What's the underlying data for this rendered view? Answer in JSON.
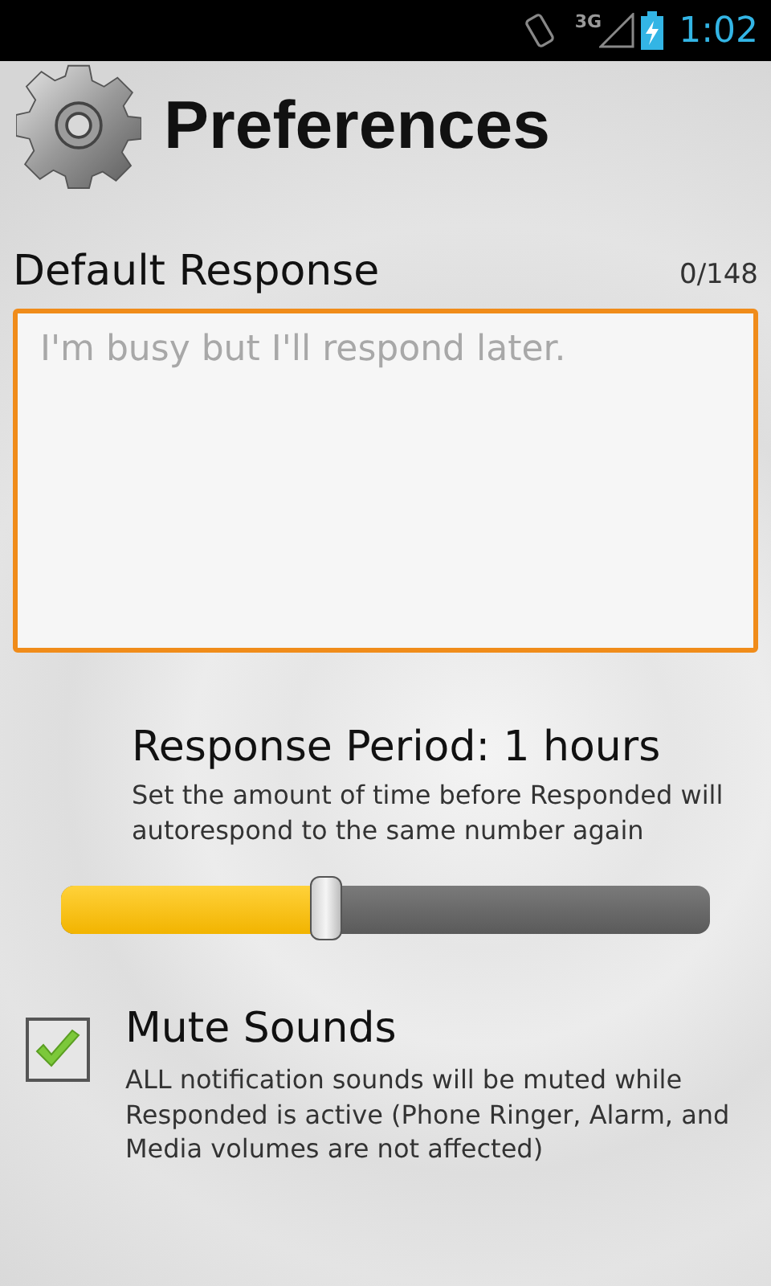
{
  "status_bar": {
    "network": "3G",
    "time": "1:02"
  },
  "header": {
    "title": "Preferences"
  },
  "default_response": {
    "label": "Default Response",
    "counter": "0/148",
    "placeholder": "I'm busy but I'll respond later."
  },
  "response_period": {
    "title": "Response Period: 1 hours",
    "description": "Set the amount of time before Responded will autorespond to the same number again",
    "level": 0.41
  },
  "mute_sounds": {
    "title": "Mute Sounds",
    "description": "ALL notification sounds will be muted while Responded is active (Phone Ringer, Alarm, and Media volumes are not affected)",
    "checked": true
  }
}
